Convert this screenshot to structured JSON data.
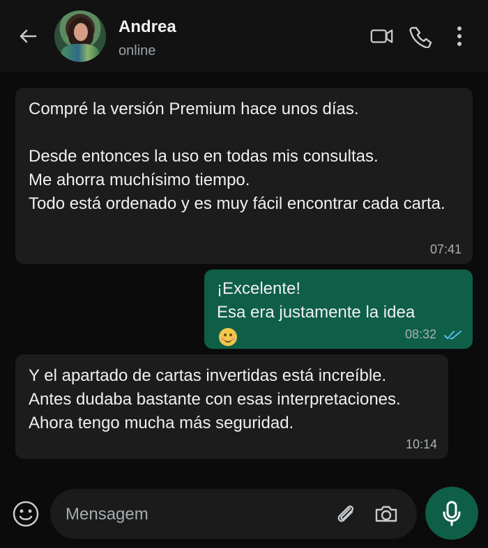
{
  "header": {
    "name": "Andrea",
    "status": "online",
    "back_icon": "arrow-left-icon",
    "video_icon": "video-camera-icon",
    "call_icon": "phone-icon",
    "menu_icon": "more-vertical-icon"
  },
  "messages": [
    {
      "direction": "incoming",
      "text": "Compré la versión Premium hace unos días.\n\nDesde entonces la uso en todas mis consultas.\nMe ahorra muchísimo tiempo.\nTodo está ordenado y es muy fácil encontrar cada carta.",
      "time": "07:41"
    },
    {
      "direction": "outgoing",
      "text": "¡Excelente!\nEsa era justamente la idea",
      "emoji": "smiling-face-icon",
      "time": "08:32",
      "status_icon": "double-check-icon"
    },
    {
      "direction": "incoming",
      "text": "Y el apartado de cartas invertidas está increíble.\nAntes dudaba bastante con esas interpretaciones.\nAhora tengo mucha más seguridad.",
      "time": "10:14"
    }
  ],
  "composer": {
    "placeholder": "Mensagem",
    "emoji_icon": "emoji-icon",
    "attach_icon": "paperclip-icon",
    "camera_icon": "camera-icon",
    "mic_icon": "microphone-icon"
  },
  "colors": {
    "background": "#0b0b0b",
    "incoming_bubble": "#1c1c1c",
    "outgoing_bubble": "#0f5f48",
    "read_ticks": "#53bdeb",
    "mic_button": "#0f5f48"
  }
}
